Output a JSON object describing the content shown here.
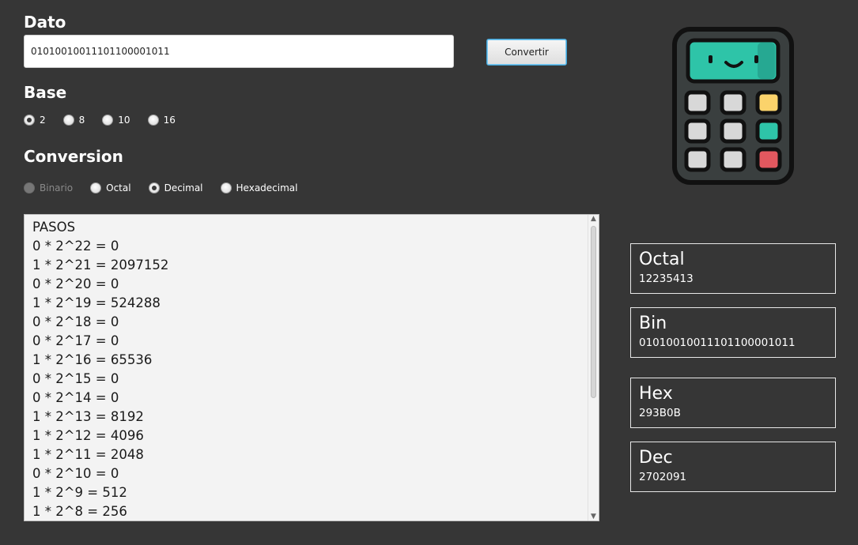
{
  "dato": {
    "title": "Dato",
    "value": "0101001001110110000101 1",
    "button": "Convertir"
  },
  "base": {
    "title": "Base",
    "options": [
      "2",
      "8",
      "10",
      "16"
    ]
  },
  "conversion": {
    "title": "Conversion",
    "options": [
      "Binario",
      "Octal",
      "Decimal",
      "Hexadecimal"
    ]
  },
  "steps": [
    "PASOS",
    "0 * 2^22 = 0",
    "1 * 2^21 = 2097152",
    "0 * 2^20 = 0",
    "1 * 2^19 = 524288",
    "0 * 2^18 = 0",
    "0 * 2^17 = 0",
    "1 * 2^16 = 65536",
    "0 * 2^15 = 0",
    "0 * 2^14 = 0",
    "1 * 2^13 = 8192",
    "1 * 2^12 = 4096",
    "1 * 2^11 = 2048",
    "0 * 2^10 = 0",
    "1 * 2^9 = 512",
    "1 * 2^8 = 256"
  ],
  "results": {
    "octal": {
      "label": "Octal",
      "value": "12235413"
    },
    "bin": {
      "label": "Bin",
      "value": "01010010011101100001011"
    },
    "hex": {
      "label": "Hex",
      "value": "293B0B"
    },
    "dec": {
      "label": "Dec",
      "value": "2702091"
    }
  },
  "colors": {
    "background": "#363636",
    "screen": "#2ec4a8",
    "yellow_key": "#fbd36b",
    "green_key": "#2ec4a8",
    "red_key": "#e2585f"
  },
  "icons": {
    "calculator": "calculator-icon"
  }
}
